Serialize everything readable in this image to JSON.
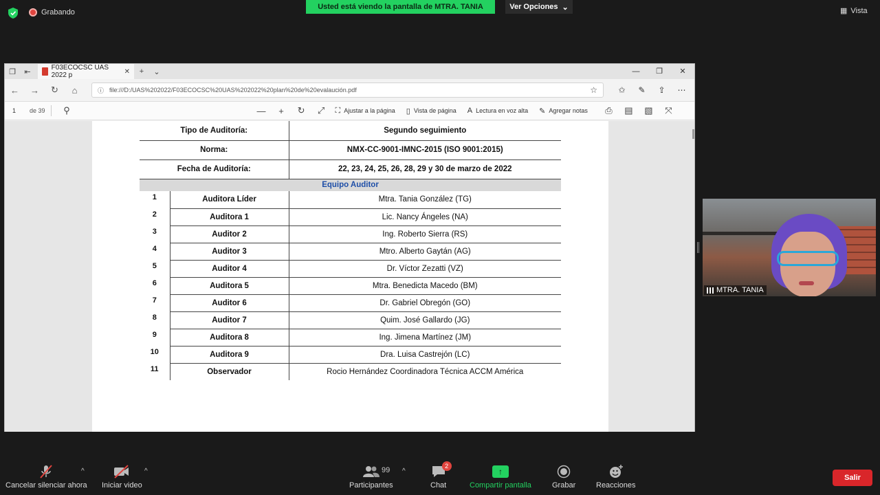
{
  "zoom": {
    "recording_label": "Grabando",
    "share_banner": "Usted está viendo la pantalla de MTRA. TANIA",
    "view_options": "Ver Opciones",
    "view_label": "Vista",
    "participant_name": "MTRA. TANIA",
    "toolbar": {
      "mute": "Cancelar silenciar ahora",
      "video": "Iniciar video",
      "participants": "Participantes",
      "participants_count": "99",
      "chat": "Chat",
      "chat_badge": "2",
      "share": "Compartir pantalla",
      "record": "Grabar",
      "reactions": "Reacciones",
      "leave": "Salir"
    },
    "colors": {
      "share_green": "#23d160",
      "leave_red": "#d9262a",
      "record_red": "#e0443e"
    }
  },
  "browser": {
    "tab_title": "F03ECOCSC UAS 2022 p",
    "url": "file:///D:/UAS%202022/F03ECOCSC%20UAS%202022%20plan%20de%20evalaución.pdf",
    "pdf_toolbar": {
      "page_current": "1",
      "page_total": "de 39",
      "fit_page": "Ajustar a la página",
      "page_view": "Vista de página",
      "read_aloud": "Lectura en voz alta",
      "add_notes": "Agregar notas"
    }
  },
  "document": {
    "header_rows": [
      {
        "label": "Tipo de Auditoría:",
        "value": "Segundo seguimiento"
      },
      {
        "label": "Norma:",
        "value": "NMX-CC-9001-IMNC-2015 (ISO 9001:2015)"
      },
      {
        "label": "Fecha de Auditoría:",
        "value": "22, 23, 24, 25, 26, 28, 29 y 30 de marzo de 2022"
      }
    ],
    "team_title": "Equipo Auditor",
    "team": [
      {
        "num": "1",
        "role": "Auditora Líder",
        "name": "Mtra. Tania González (TG)"
      },
      {
        "num": "2",
        "role": "Auditora 1",
        "name": "Lic. Nancy Ángeles (NA)"
      },
      {
        "num": "3",
        "role": "Auditor 2",
        "name": "Ing. Roberto Sierra (RS)"
      },
      {
        "num": "4",
        "role": "Auditor 3",
        "name": "Mtro. Alberto Gaytán (AG)"
      },
      {
        "num": "5",
        "role": "Auditor 4",
        "name": "Dr. Víctor Zezatti (VZ)"
      },
      {
        "num": "6",
        "role": "Auditora 5",
        "name": "Mtra. Benedicta Macedo (BM)"
      },
      {
        "num": "7",
        "role": "Auditor 6",
        "name": "Dr. Gabriel Obregón (GO)"
      },
      {
        "num": "8",
        "role": "Auditor 7",
        "name": "Quim. José Gallardo (JG)"
      },
      {
        "num": "9",
        "role": "Auditora 8",
        "name": "Ing. Jimena Martínez (JM)"
      },
      {
        "num": "10",
        "role": "Auditora 9",
        "name": "Dra. Luisa Castrejón (LC)"
      },
      {
        "num": "11",
        "role": "Observador",
        "name": "Rocio Hernández Coordinadora Técnica ACCM América"
      }
    ]
  }
}
